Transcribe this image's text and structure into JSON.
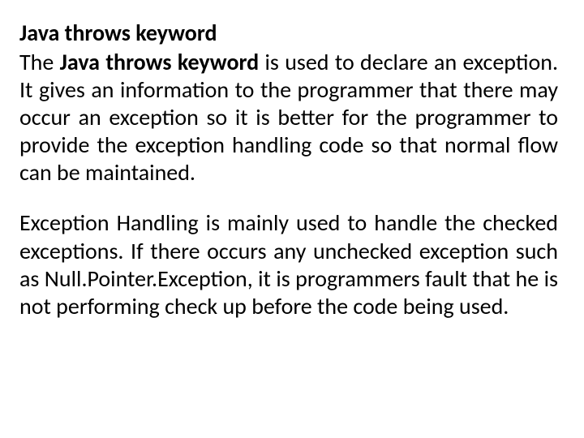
{
  "heading": "Java throws keyword",
  "p1_prefix": "The ",
  "p1_bold": "Java throws keyword",
  "p1_rest": " is used to declare an exception. It gives an information to the programmer that there may occur an exception so it is better for the programmer to provide the exception handling code so that normal flow can be maintained.",
  "p2": "Exception Handling is mainly used to handle the checked exceptions. If there occurs any unchecked exception such as Null.Pointer.Exception, it is programmers fault that he is not performing check up before the code being used."
}
